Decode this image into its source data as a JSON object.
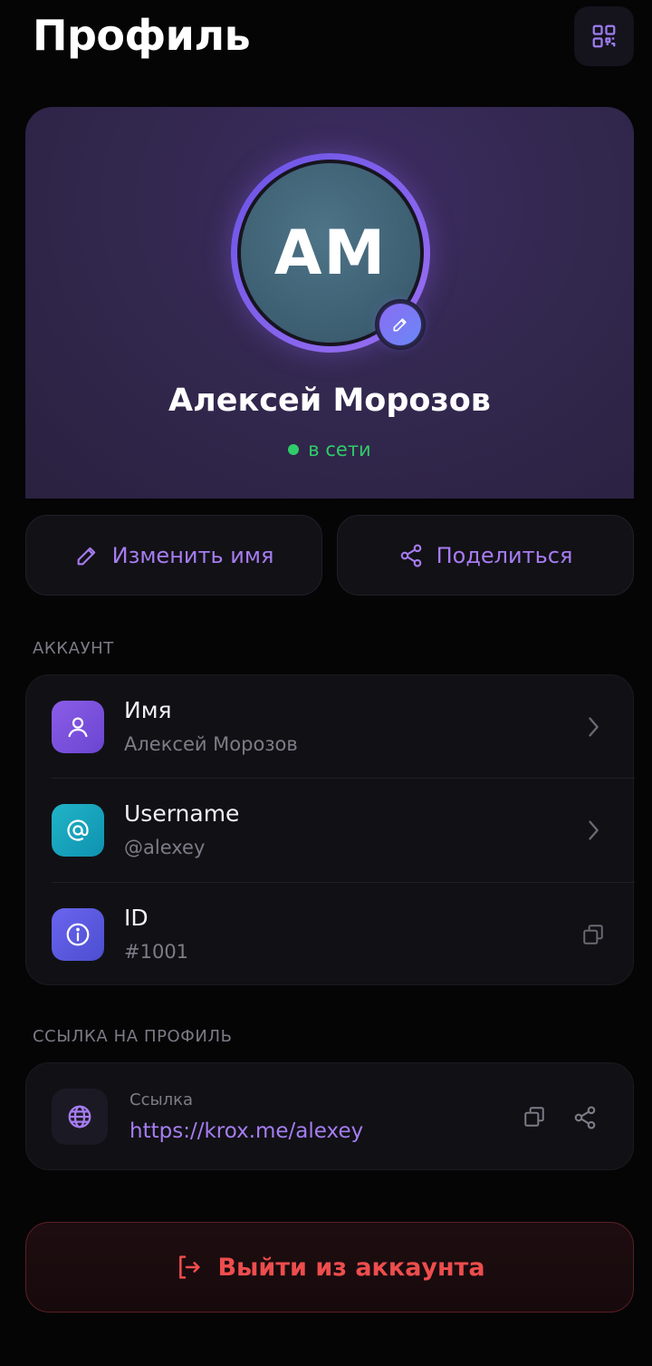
{
  "header": {
    "title": "Профиль",
    "qr_icon": "qr-code-icon"
  },
  "profile": {
    "initials": "AM",
    "name": "Алексей Морозов",
    "status": "в сети",
    "status_color": "#2fcc69",
    "edit_icon": "pencil-icon"
  },
  "actions": {
    "rename_label": "Изменить имя",
    "share_label": "Поделиться",
    "accent_color": "#a77cf0"
  },
  "account": {
    "section_label": "АККАУНТ",
    "rows": [
      {
        "title": "Имя",
        "value": "Алексей Морозов",
        "icon": "user-icon",
        "trailing": "chevron-right-icon"
      },
      {
        "title": "Username",
        "value": "@alexey",
        "icon": "at-sign-icon",
        "trailing": "chevron-right-icon"
      },
      {
        "title": "ID",
        "value": "#1001",
        "icon": "info-icon",
        "trailing": "copy-icon"
      }
    ]
  },
  "profile_link": {
    "section_label": "ССЫЛКА НА ПРОФИЛЬ",
    "caption": "Ссылка",
    "url": "https://krox.me/alexey",
    "icon": "globe-icon"
  },
  "logout": {
    "label": "Выйти из аккаунта",
    "color": "#ee4d4d",
    "icon": "logout-icon"
  }
}
